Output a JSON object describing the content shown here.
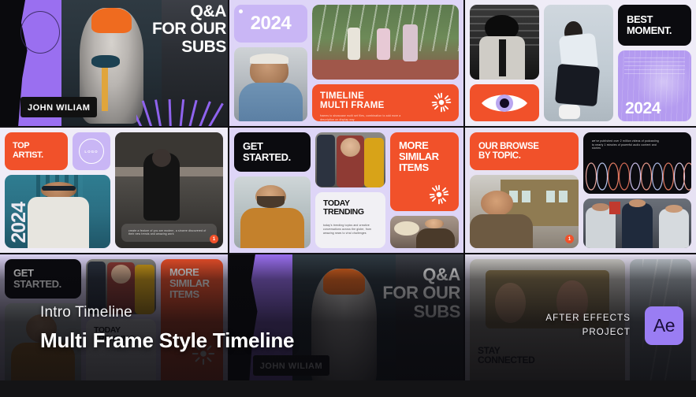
{
  "meta": {
    "kind": "video-preview-frame",
    "title_overlay_subtitle": "Intro Timeline",
    "title_overlay_title": "Multi Frame Style Timeline",
    "footer_credit_line1": "AFTER EFFECTS",
    "footer_credit_line2": "PROJECT",
    "ae_badge_label": "Ae"
  },
  "colors": {
    "orange": "#f1512a",
    "lavender": "#c9b6f5",
    "lavender_deep": "#9a7df3",
    "black_card": "#0b0b0f",
    "white_card": "#f1f0f4",
    "panel_bg": "#cfc2f2",
    "scrim": "#08080c"
  },
  "row1": {
    "hero": {
      "headline_l1": "Q&A",
      "headline_l2": "FOR OUR",
      "headline_l3": "SUBS",
      "name_tag": "JOHN WILIAM"
    },
    "year_card": {
      "label": "2024"
    },
    "portrait_card": {
      "alt": "young man in blue tee"
    },
    "group_photo": {
      "alt": "three friends walking outdoors"
    },
    "timeline_banner": {
      "line1": "TIMELINE",
      "line2": "MULTI FRAME",
      "body": "frames to showcase multi set files, combination to add more a description on display way",
      "icon": "starburst-icon"
    },
    "bw_portrait": {
      "alt": "black and white portrait"
    },
    "eye_card": {
      "icon": "eye-icon"
    },
    "seated_portrait": {
      "alt": "man seated in white shirt"
    },
    "best_moment": {
      "label_l1": "BEST",
      "label_l2": "MOMENT."
    },
    "purple_2024": {
      "label": "2024"
    }
  },
  "row2": {
    "top_artist": {
      "label_l1": "TOP",
      "label_l2": "ARTIST."
    },
    "logo_card": {
      "label": "LOGO"
    },
    "artist_2024": {
      "vertical_label": "2024"
    },
    "fashion_photo": {
      "caption": "create a feature of you are modern, a sincere discovered of their new trends and amazing work",
      "badge": "1"
    },
    "get_started": {
      "label_l1": "GET",
      "label_l2": "STARTED."
    },
    "beard_portrait": {
      "alt": "man in ochre sweater"
    },
    "street_photo": {
      "alt": "woman in plaid jacket on street"
    },
    "today_trending": {
      "line1": "TODAY",
      "line2": "TRENDING",
      "body": "today's trending topics and creative conversations across the globe, from amazing news to viral challenges"
    },
    "more_similar": {
      "line1": "MORE",
      "line2": "SIMILAR",
      "line3": "ITEMS",
      "icon": "starburst-icon"
    },
    "hat_photo": {
      "alt": "man with straw hat"
    },
    "our_browse": {
      "label_l1": "OUR BROWSE",
      "label_l2": "BY TOPIC."
    },
    "office_photo": {
      "alt": "smiling man at office wall",
      "badge": "1"
    },
    "audio_card": {
      "body": "we've published over 2 million videos of podcasting to nearly 1 minutes of powerful audio content and stories"
    },
    "crew_photo": {
      "alt": "three men seated together"
    }
  },
  "row3": {
    "get_started": {
      "label_l1": "GET",
      "label_l2": "STARTED."
    },
    "more_similar": {
      "line1": "MORE",
      "line2": "SIMILAR",
      "line3": "ITEMS"
    },
    "hero_repeat": {
      "headline_l1": "Q&A",
      "headline_l2": "FOR OUR",
      "headline_l3": "SUBS",
      "name_tag": "JOHN WILIAM"
    },
    "stay_connected": {
      "label_l1": "STAY",
      "label_l2": "CONNECTED"
    }
  }
}
